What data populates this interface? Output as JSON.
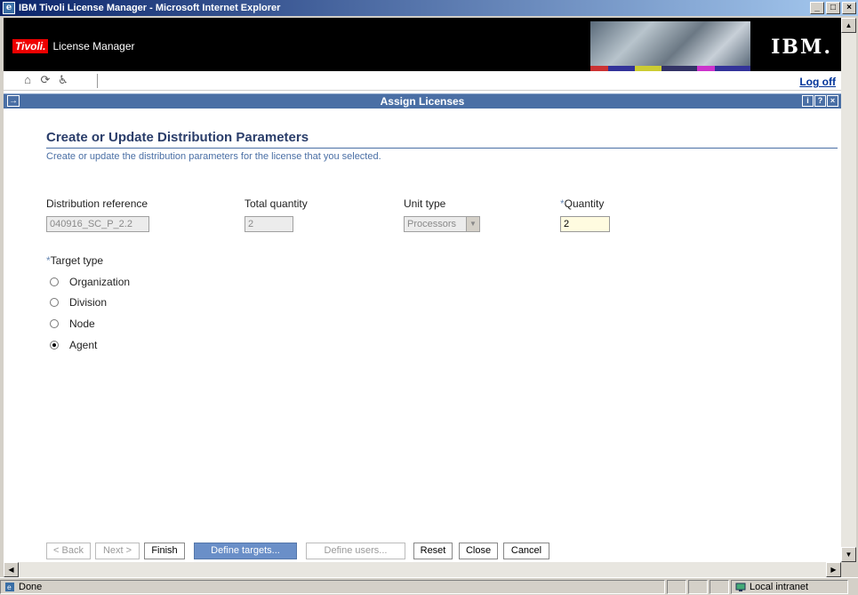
{
  "window": {
    "title": "IBM Tivoli License Manager - Microsoft Internet Explorer"
  },
  "banner": {
    "brand": "Tivoli.",
    "product": "License Manager",
    "logo": "IBM."
  },
  "toolbar": {
    "logoff": "Log off"
  },
  "portlet": {
    "title": "Assign Licenses"
  },
  "page": {
    "heading": "Create or Update Distribution Parameters",
    "description": "Create or update the distribution parameters for the license that you selected."
  },
  "form": {
    "distribution_reference": {
      "label": "Distribution reference",
      "value": "040916_SC_P_2.2"
    },
    "total_quantity": {
      "label": "Total quantity",
      "value": "2"
    },
    "unit_type": {
      "label": "Unit type",
      "value": "Processors"
    },
    "quantity": {
      "label": "Quantity",
      "value": "2",
      "required_marker": "*"
    },
    "target_type": {
      "label": "Target type",
      "required_marker": "*",
      "options": [
        "Organization",
        "Division",
        "Node",
        "Agent"
      ],
      "selected": "Agent"
    }
  },
  "buttons": {
    "back": "< Back",
    "next": "Next >",
    "finish": "Finish",
    "define_targets": "Define targets...",
    "define_users": "Define users...",
    "reset": "Reset",
    "close": "Close",
    "cancel": "Cancel"
  },
  "statusbar": {
    "status": "Done",
    "zone": "Local intranet"
  }
}
